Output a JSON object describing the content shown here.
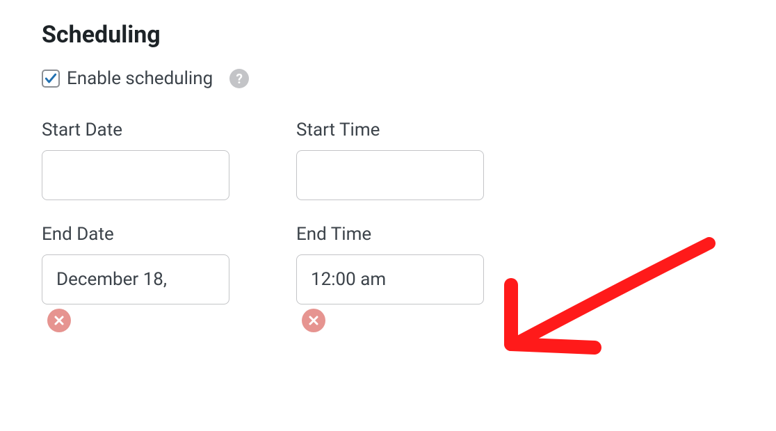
{
  "section": {
    "title": "Scheduling",
    "enable_label": "Enable scheduling",
    "enable_checked": true
  },
  "fields": {
    "start_date": {
      "label": "Start Date",
      "value": ""
    },
    "start_time": {
      "label": "Start Time",
      "value": ""
    },
    "end_date": {
      "label": "End Date",
      "value": "December 18,"
    },
    "end_time": {
      "label": "End Time",
      "value": "12:00 am"
    }
  },
  "colors": {
    "checkmark": "#2271b1",
    "clear_button": "#e69490",
    "arrow": "#ff1a1a"
  }
}
